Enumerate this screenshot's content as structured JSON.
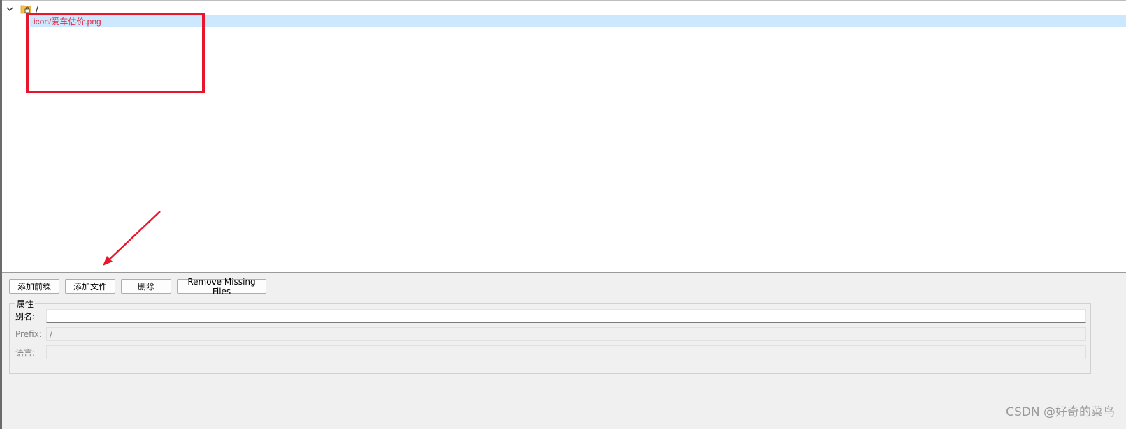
{
  "tree": {
    "root_label": "/",
    "child_label": "icon/爱车估价.png"
  },
  "toolbar": {
    "add_prefix": "添加前缀",
    "add_files": "添加文件",
    "remove": "删除",
    "remove_missing": "Remove Missing Files"
  },
  "properties": {
    "title": "属性",
    "alias_label": "别名:",
    "alias_value": "",
    "prefix_label": "Prefix:",
    "prefix_value": "/",
    "language_label": "语言:",
    "language_value": ""
  },
  "watermark": "CSDN @好奇的菜鸟",
  "colors": {
    "selection": "#cce8ff",
    "annotation": "#e8162a",
    "child_text": "#e0304a"
  },
  "icons": {
    "expand": "chevron-down-icon",
    "folder": "folder-lock-icon"
  }
}
